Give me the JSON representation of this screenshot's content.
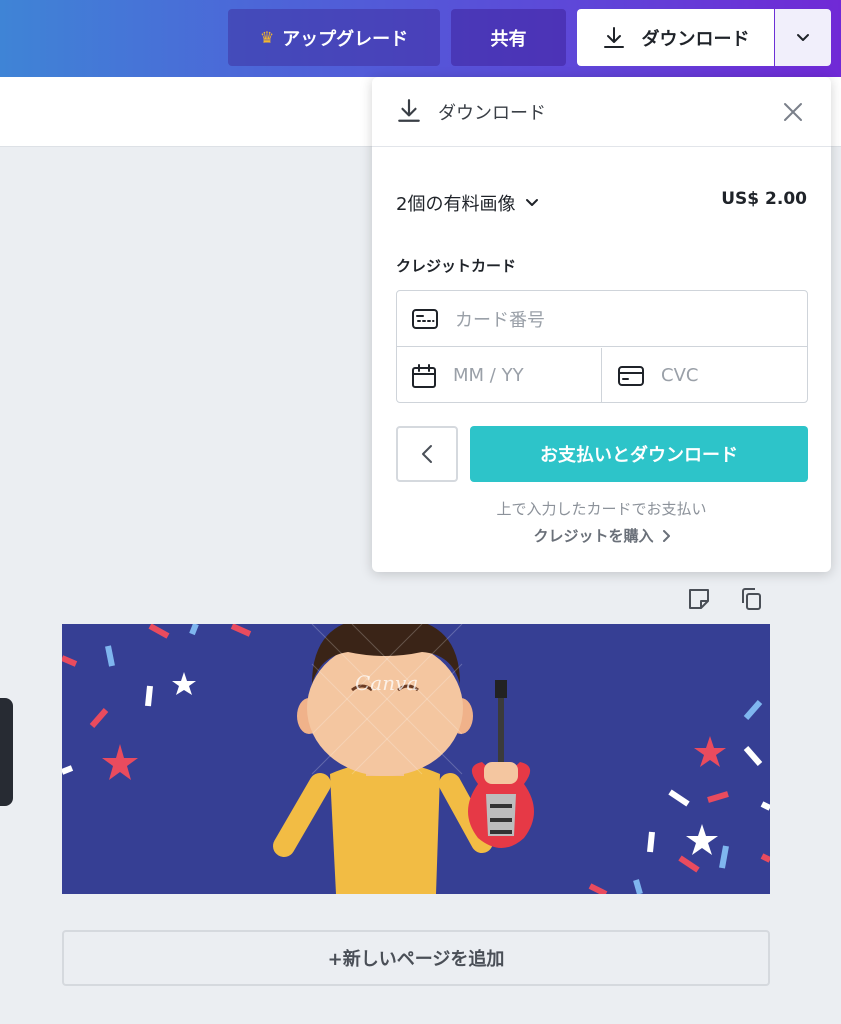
{
  "header": {
    "upgrade_label": "アップグレード",
    "share_label": "共有",
    "download_label": "ダウンロード"
  },
  "download_panel": {
    "title": "ダウンロード",
    "items_label": "2個の有料画像",
    "price": "US$ 2.00",
    "credit_card_label": "クレジットカード",
    "card_number_placeholder": "カード番号",
    "expiry_placeholder": "MM / YY",
    "cvc_placeholder": "CVC",
    "pay_button_label": "お支払いとダウンロード",
    "note": "上で入力したカードでお支払い",
    "buy_credits_label": "クレジットを購入"
  },
  "canvas": {
    "watermark": "Canva"
  },
  "add_page_label": "+新しいページを追加",
  "colors": {
    "accent_teal": "#2dc4c9",
    "canvas_background": "#363f94",
    "crown": "#f5b82e"
  },
  "icons": [
    "crown-icon",
    "download-icon",
    "chevron-down-icon",
    "close-icon",
    "card-icon",
    "calendar-icon",
    "credit-card-icon",
    "chevron-left-icon",
    "chevron-right-icon",
    "note-icon",
    "copy-icon"
  ]
}
